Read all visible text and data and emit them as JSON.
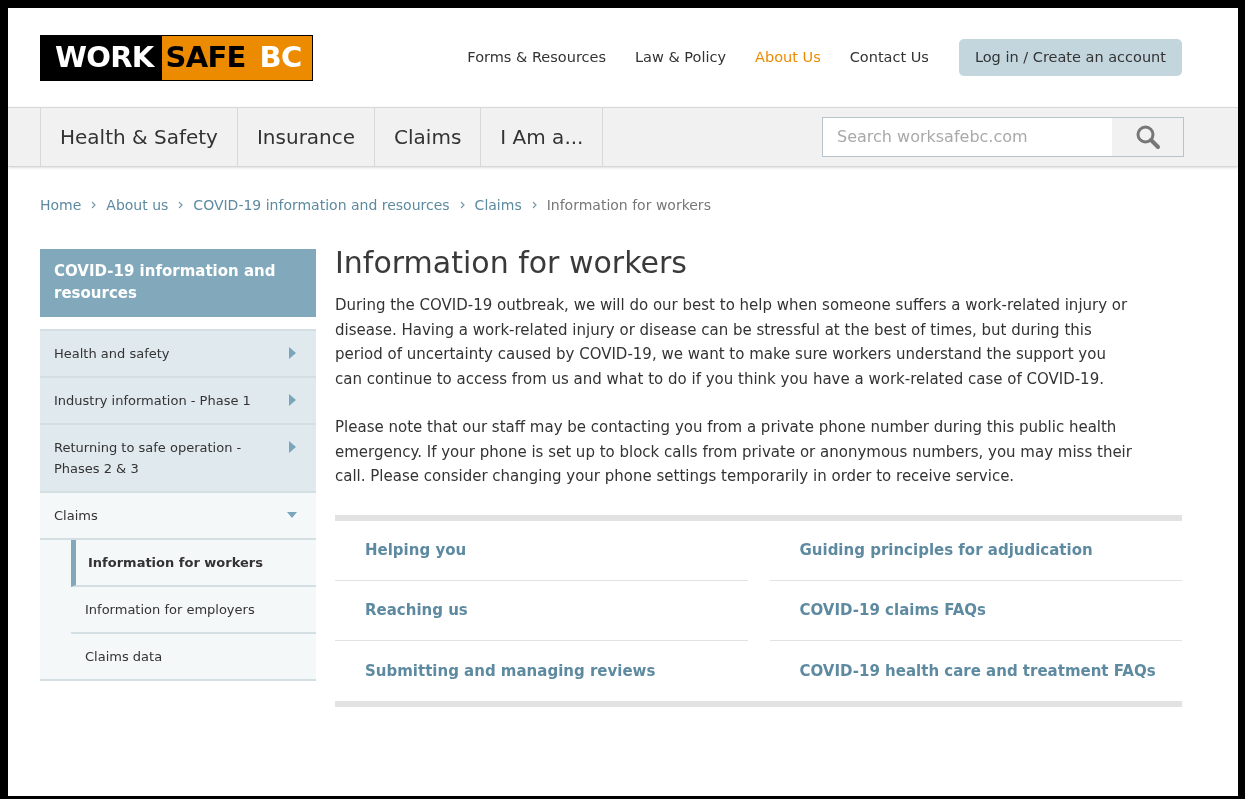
{
  "logo": {
    "parts": [
      {
        "text": "WORK",
        "kind": "dark"
      },
      {
        "text": "SAFE",
        "kind": "orange"
      },
      {
        "text": "BC",
        "kind": "orange-light"
      }
    ]
  },
  "top_nav": [
    {
      "label": "Forms & Resources",
      "selected": false
    },
    {
      "label": "Law & Policy",
      "selected": false
    },
    {
      "label": "About Us",
      "selected": true
    },
    {
      "label": "Contact Us",
      "selected": false
    }
  ],
  "login_button": "Log in / Create an account",
  "main_nav": [
    "Health & Safety",
    "Insurance",
    "Claims",
    "I Am a..."
  ],
  "search": {
    "placeholder": "Search worksafebc.com"
  },
  "breadcrumb": [
    {
      "label": "Home",
      "current": false
    },
    {
      "label": "About us",
      "current": false
    },
    {
      "label": "COVID-19 information and resources",
      "current": false
    },
    {
      "label": "Claims",
      "current": false
    },
    {
      "label": "Information for workers",
      "current": true
    }
  ],
  "sidebar": {
    "title": "COVID-19 information and resources",
    "items": [
      {
        "label": "Health and safety",
        "expanded": false
      },
      {
        "label": "Industry information - Phase 1",
        "expanded": false
      },
      {
        "label": "Returning to safe operation - Phases 2 & 3",
        "expanded": false
      },
      {
        "label": "Claims",
        "expanded": true,
        "children": [
          {
            "label": "Information for workers",
            "selected": true
          },
          {
            "label": "Information for employers",
            "selected": false
          },
          {
            "label": "Claims data",
            "selected": false
          }
        ]
      }
    ]
  },
  "main": {
    "title": "Information for workers",
    "paragraphs": [
      "During the COVID-19 outbreak, we will do our best to help when someone suffers a work-related injury or disease. Having a work-related injury or disease can be stressful at the best of times, but during this period of uncertainty caused by COVID-19, we want to make sure workers understand the support you can continue to access from us and what to do if you think you have a work-related case of COVID-19.",
      "Please note that our staff may be contacting you from a private phone number during this public health emergency. If your phone is set up to block calls from private or anonymous numbers, you may miss their call. Please consider changing your phone settings temporarily in order to receive service."
    ],
    "links": [
      [
        "Helping you",
        "Reaching us",
        "Submitting and managing reviews"
      ],
      [
        "Guiding principles for adjudication",
        "COVID-19 claims FAQs",
        "COVID-19 health care and treatment FAQs"
      ]
    ]
  }
}
